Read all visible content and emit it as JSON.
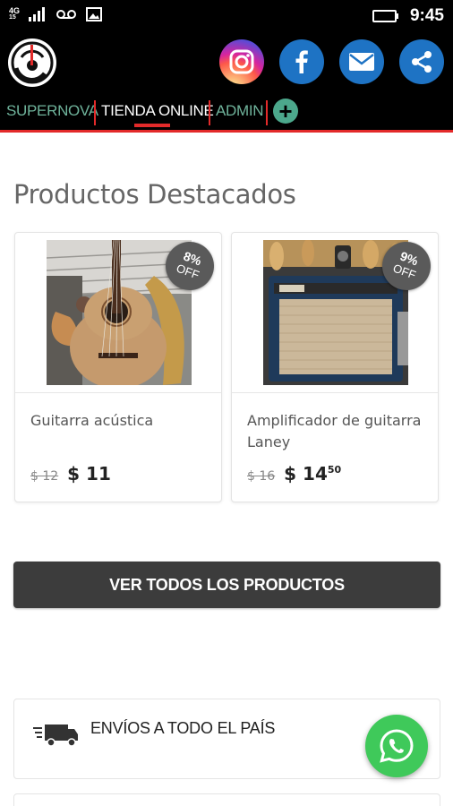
{
  "status_bar": {
    "network": "4G",
    "network_sub": "15",
    "time": "9:45",
    "icons": [
      "signal-icon",
      "voicemail-icon",
      "image-icon",
      "battery-icon"
    ]
  },
  "header": {
    "social": [
      "instagram",
      "facebook",
      "email",
      "share"
    ],
    "nav": {
      "items": [
        "SUPERNOVA",
        "TIENDA ONLINE",
        "ADMIN"
      ],
      "active": "TIENDA ONLINE",
      "add_label": "+"
    },
    "colors": {
      "accent": "#e32a2a",
      "nav_green": "#6fb39b",
      "social_blue": "#1e73c4"
    }
  },
  "main": {
    "section_title": "Productos Destacados",
    "products": [
      {
        "name": "Guitarra acústica",
        "discount": "8%",
        "off": "OFF",
        "old_price": "$ 12",
        "new_price": "$ 11",
        "new_price_cents": ""
      },
      {
        "name": "Amplificador de guitarra Laney",
        "discount": "9%",
        "off": "OFF",
        "old_price": "$ 16",
        "new_price": "$ 14",
        "new_price_cents": "50"
      }
    ],
    "view_all_label": "VER TODOS LOS PRODUCTOS",
    "shipping_label": "ENVÍOS A TODO EL PAÍS"
  }
}
